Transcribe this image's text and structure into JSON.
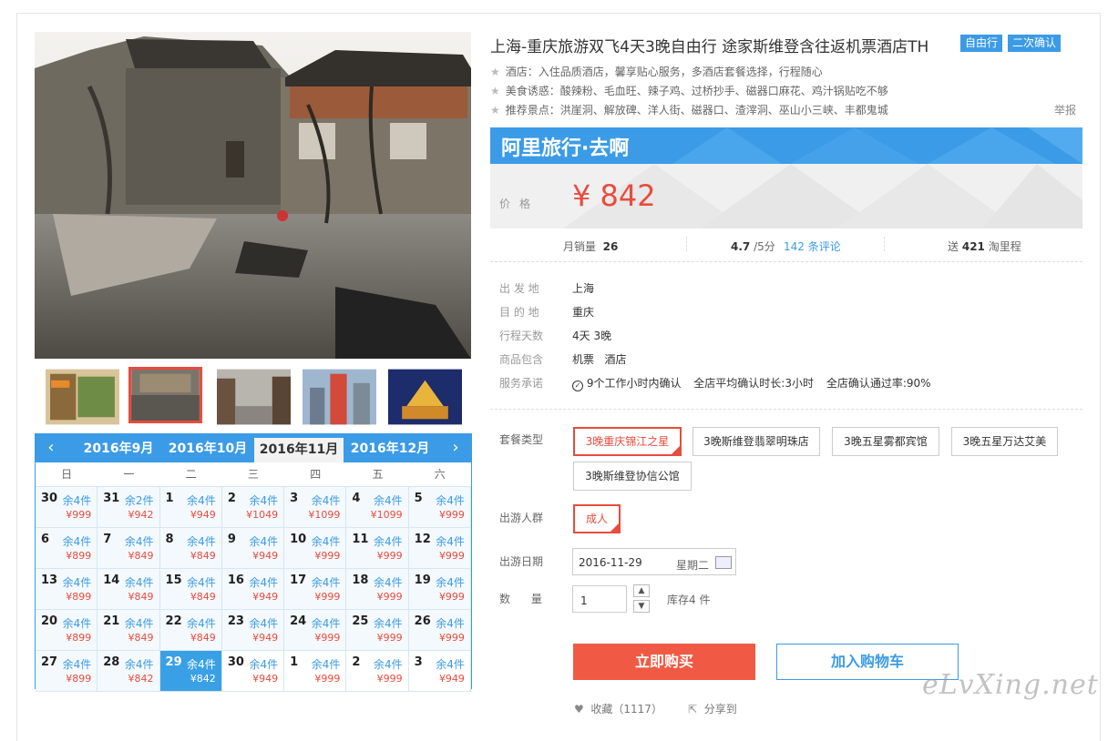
{
  "product": {
    "title": "上海-重庆旅游双飞4天3晚自由行 途家斯维登含往返机票酒店TH",
    "badges": [
      "自由行",
      "二次确认"
    ],
    "features": [
      "酒店：入住品质酒店，馨享贴心服务，多酒店套餐选择，行程随心",
      "美食诱惑：酸辣粉、毛血旺、辣子鸡、过桥抄手、磁器口麻花、鸡汁锅贴吃不够",
      "推荐景点：洪崖洞、解放碑、洋人街、磁器口、渣滓洞、巫山小三峡、丰都鬼城"
    ],
    "report": "举报"
  },
  "banner": {
    "brand": "阿里旅行·去啊",
    "price_label": "价格",
    "price": "¥ 842"
  },
  "stats": {
    "monthly_label": "月销量",
    "monthly_value": "26",
    "rating_value": "4.7",
    "rating_suffix": "/5分",
    "reviews": "142 条评论",
    "points_prefix": "送",
    "points_value": "421",
    "points_suffix": "淘里程"
  },
  "info": {
    "departure_label": "出 发 地",
    "departure": "上海",
    "destination_label": "目 的 地",
    "destination": "重庆",
    "days_label": "行程天数",
    "days": "4天 3晚",
    "includes_label": "商品包含",
    "includes": "机票   酒店",
    "service_label": "服务承诺",
    "service": [
      "9个工作小时内确认",
      "全店平均确认时长:3小时",
      "全店确认通过率:90%"
    ]
  },
  "options": {
    "package_label": "套餐类型",
    "packages": [
      "3晚重庆锦江之星",
      "3晚斯维登翡翠明珠店",
      "3晚五星雾都宾馆",
      "3晚五星万达艾美",
      "3晚斯维登协信公馆"
    ],
    "selected_package": 0,
    "group_label": "出游人群",
    "group": "成人",
    "date_label": "出游日期",
    "date_value": "2016-11-29",
    "date_weekday": "星期二",
    "qty_label": "数      量",
    "qty_value": "1",
    "stock": "库存4 件"
  },
  "actions": {
    "buy": "立即购买",
    "cart": "加入购物车",
    "favorite": "收藏（1117）",
    "share": "分享到"
  },
  "calendar": {
    "months": [
      "2016年9月",
      "2016年10月",
      "2016年11月",
      "2016年12月"
    ],
    "active_month": 2,
    "weekdays": [
      "日",
      "一",
      "二",
      "三",
      "四",
      "五",
      "六"
    ],
    "days": [
      {
        "d": "30",
        "s": "余4件",
        "p": "¥999",
        "past": true
      },
      {
        "d": "31",
        "s": "余2件",
        "p": "¥942",
        "past": true
      },
      {
        "d": "1",
        "s": "余4件",
        "p": "¥949",
        "past": true
      },
      {
        "d": "2",
        "s": "余4件",
        "p": "¥1049",
        "past": true
      },
      {
        "d": "3",
        "s": "余4件",
        "p": "¥1099",
        "past": true
      },
      {
        "d": "4",
        "s": "余4件",
        "p": "¥1099",
        "past": true
      },
      {
        "d": "5",
        "s": "余4件",
        "p": "¥999",
        "past": true
      },
      {
        "d": "6",
        "s": "余4件",
        "p": "¥899",
        "past": true
      },
      {
        "d": "7",
        "s": "余4件",
        "p": "¥849",
        "past": true
      },
      {
        "d": "8",
        "s": "余4件",
        "p": "¥849",
        "past": true
      },
      {
        "d": "9",
        "s": "余4件",
        "p": "¥949",
        "past": true
      },
      {
        "d": "10",
        "s": "余4件",
        "p": "¥999",
        "past": true
      },
      {
        "d": "11",
        "s": "余4件",
        "p": "¥999",
        "past": true
      },
      {
        "d": "12",
        "s": "余4件",
        "p": "¥999",
        "past": true
      },
      {
        "d": "13",
        "s": "余4件",
        "p": "¥899",
        "past": true
      },
      {
        "d": "14",
        "s": "余4件",
        "p": "¥849",
        "past": true
      },
      {
        "d": "15",
        "s": "余4件",
        "p": "¥849",
        "past": true
      },
      {
        "d": "16",
        "s": "余4件",
        "p": "¥949",
        "past": true
      },
      {
        "d": "17",
        "s": "余4件",
        "p": "¥999",
        "past": true
      },
      {
        "d": "18",
        "s": "余4件",
        "p": "¥999",
        "past": true
      },
      {
        "d": "19",
        "s": "余4件",
        "p": "¥999",
        "past": true
      },
      {
        "d": "20",
        "s": "余4件",
        "p": "¥899",
        "past": true
      },
      {
        "d": "21",
        "s": "余4件",
        "p": "¥849",
        "past": true
      },
      {
        "d": "22",
        "s": "余4件",
        "p": "¥849",
        "past": true
      },
      {
        "d": "23",
        "s": "余4件",
        "p": "¥949",
        "past": true
      },
      {
        "d": "24",
        "s": "余4件",
        "p": "¥999",
        "past": true
      },
      {
        "d": "25",
        "s": "余4件",
        "p": "¥999",
        "past": true
      },
      {
        "d": "26",
        "s": "余4件",
        "p": "¥999",
        "past": true
      },
      {
        "d": "27",
        "s": "余4件",
        "p": "¥899",
        "past": true
      },
      {
        "d": "28",
        "s": "余4件",
        "p": "¥842",
        "past": true
      },
      {
        "d": "29",
        "s": "余4件",
        "p": "¥842",
        "sel": true
      },
      {
        "d": "30",
        "s": "余4件",
        "p": "¥949"
      },
      {
        "d": "1",
        "s": "余4件",
        "p": "¥999"
      },
      {
        "d": "2",
        "s": "余4件",
        "p": "¥999"
      },
      {
        "d": "3",
        "s": "余4件",
        "p": "¥949"
      }
    ]
  },
  "watermark": "eLvXing.net",
  "colors": {
    "accent": "#3b9be6",
    "price": "#e84c3d",
    "buy": "#f05a44"
  }
}
